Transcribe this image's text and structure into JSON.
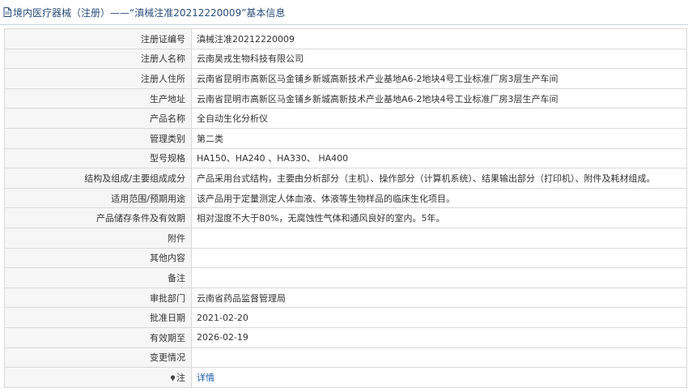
{
  "header": {
    "icon": "document-icon",
    "title": "境内医疗器械（注册）——“滇械注准20212220009”基本信息"
  },
  "rows": [
    {
      "label": "注册证编号",
      "value": "滇械注准20212220009"
    },
    {
      "label": "注册人名称",
      "value": "云南昊戎生物科技有限公司"
    },
    {
      "label": "注册人住所",
      "value": "云南省昆明市高新区马金铺乡新城高新技术产业基地A6-2地块4号工业标准厂房3层生产车间"
    },
    {
      "label": "生产地址",
      "value": "云南省昆明市高新区马金铺乡新城高新技术产业基地A6-2地块4号工业标准厂房3层生产车间"
    },
    {
      "label": "产品名称",
      "value": "全自动生化分析仪"
    },
    {
      "label": "管理类别",
      "value": "第二类"
    },
    {
      "label": "型号规格",
      "value": "HA150、HA240 、HA330、 HA400"
    },
    {
      "label": "结构及组成/主要组成成分",
      "value": "产品采用台式结构，主要由分析部分（主机）、操作部分（计算机系统）、结果输出部分（打印机）、附件及耗材组成。"
    },
    {
      "label": "适用范围/预期用途",
      "value": "该产品用于定量测定人体血液、体液等生物样品的临床生化项目。"
    },
    {
      "label": "产品储存条件及有效期",
      "value": "相对湿度不大于80%，无腐蚀性气体和通风良好的室内。5年。"
    },
    {
      "label": "附件",
      "value": ""
    },
    {
      "label": "其他内容",
      "value": ""
    },
    {
      "label": "备注",
      "value": ""
    },
    {
      "label": "审批部门",
      "value": "云南省药品监督管理局"
    },
    {
      "label": "批准日期",
      "value": "2021-02-20"
    },
    {
      "label": "有效期至",
      "value": "2026-02-19"
    },
    {
      "label": "变更情况",
      "value": ""
    }
  ],
  "note": {
    "icon": "pin-icon",
    "label": "注",
    "link_text": "详情"
  },
  "colors": {
    "header_text": "#2a4d7a",
    "label_bg": "#f6f6f6",
    "border": "#d9d9d9",
    "link": "#1a57a8"
  }
}
